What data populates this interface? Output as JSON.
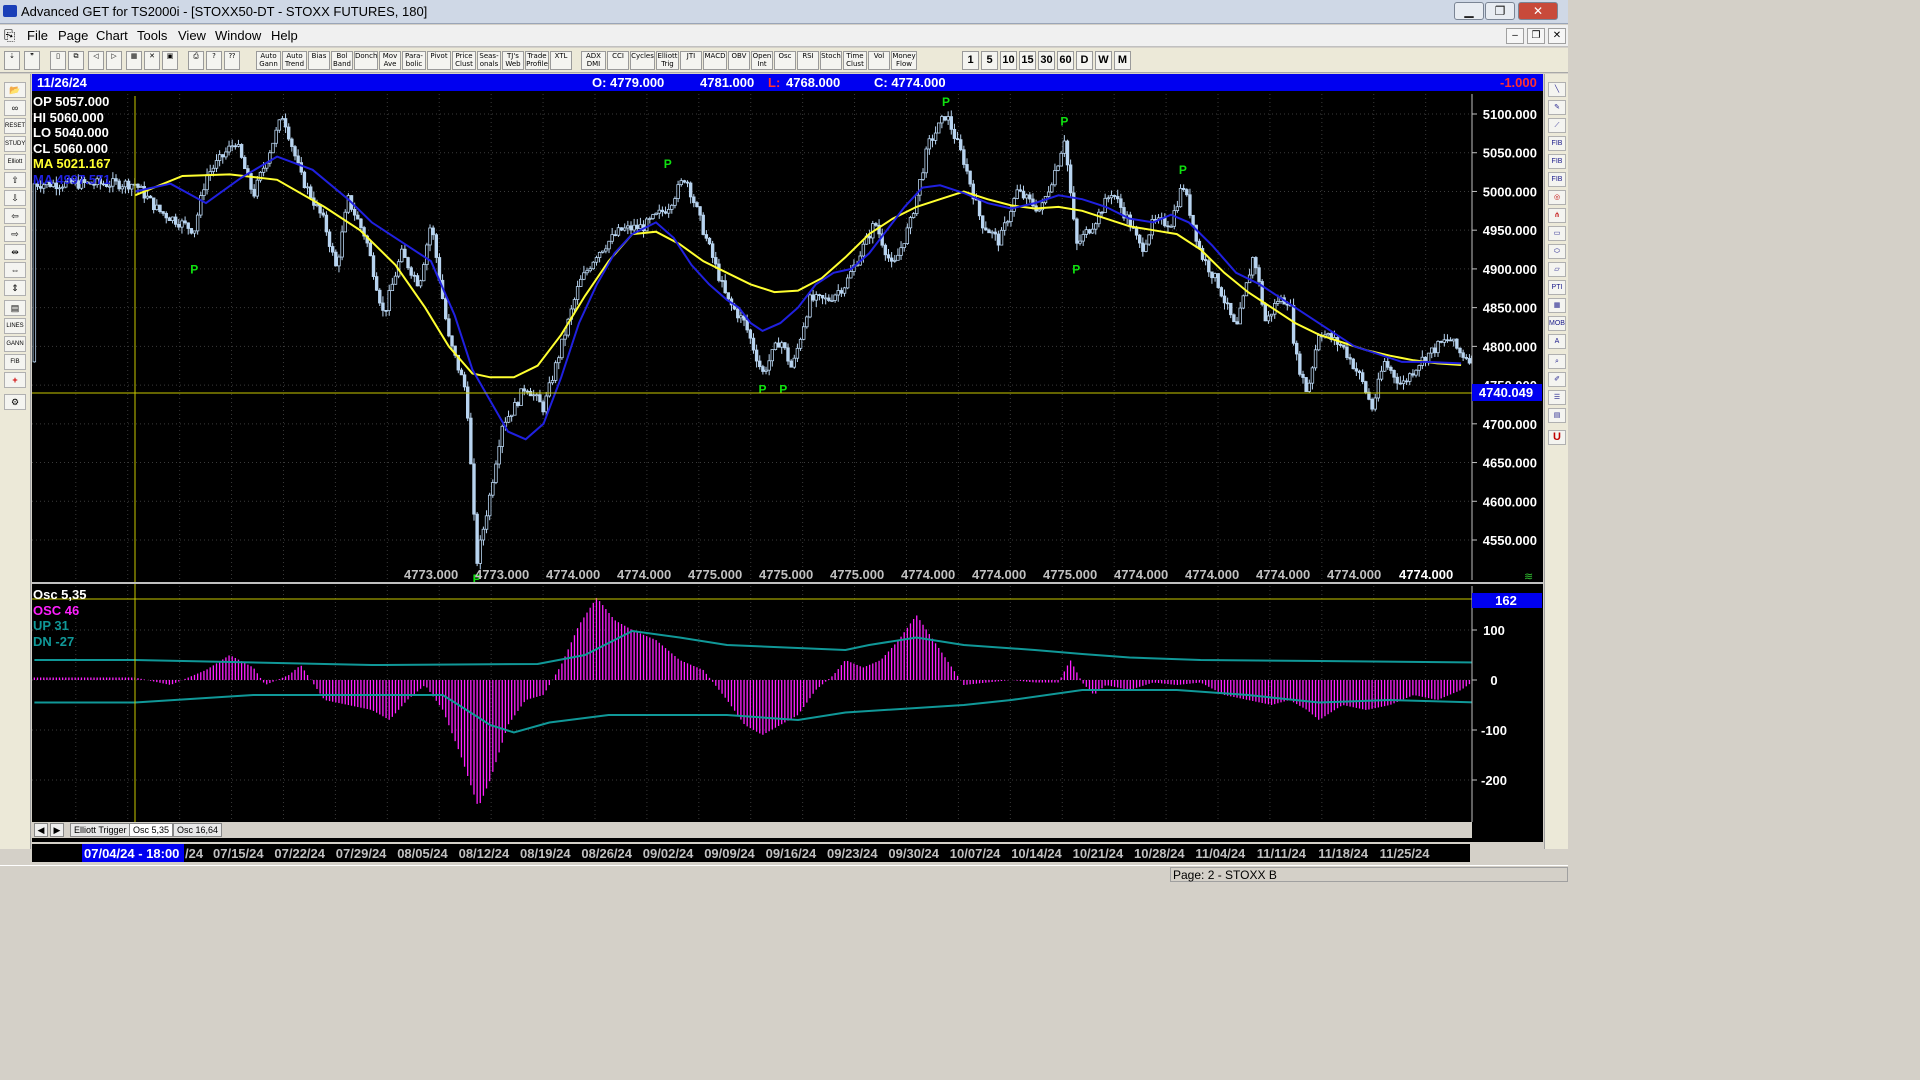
{
  "window": {
    "title": "Advanced GET for TS2000i - [STOXX50-DT - STOXX FUTURES, 180]",
    "min": "▁",
    "max": "❐",
    "close": "✕"
  },
  "menu": [
    "File",
    "Page",
    "Chart",
    "Tools",
    "View",
    "Window",
    "Help"
  ],
  "toolbar": {
    "groups": [
      "Auto Gann",
      "Auto Trend",
      "Bias",
      "Bol Band",
      "Donch",
      "Mov Ave",
      "Para-bolic",
      "Pivot",
      "Price Clust",
      "Seas-onals",
      "TJ's Web",
      "Trade Profile",
      "XTL",
      "ADX DMI",
      "CCI",
      "Cycles",
      "Elliott Trig",
      "JTI",
      "MACD",
      "OBV",
      "Open Int",
      "Osc",
      "RSI",
      "Stoch",
      "Time Clust",
      "Vol",
      "Money Flow"
    ],
    "timeframes": [
      "1",
      "5",
      "10",
      "15",
      "30",
      "60",
      "D",
      "W",
      "M"
    ]
  },
  "header": {
    "date": "11/26/24",
    "open": "O: 4779.000",
    "high": "4781.000",
    "low_label": "L:",
    "low": "4768.000",
    "close": "C: 4774.000",
    "change": "-1.000"
  },
  "legend": {
    "op": "OP  5057.000",
    "hi": "HI   5060.000",
    "lo": "LO  5040.000",
    "cl": "CL  5060.000",
    "ma1": "MA  5021.167",
    "ma2": "MA  4997.571"
  },
  "price_axis": {
    "ticks": [
      "5100.000",
      "5050.000",
      "5000.000",
      "4950.000",
      "4900.000",
      "4850.000",
      "4800.000",
      "4750.000",
      "4700.000",
      "4650.000",
      "4600.000",
      "4550.000"
    ],
    "cursor_price": "4740.049"
  },
  "bottom_values": [
    "4773.000",
    "4773.000",
    "4774.000",
    "4774.000",
    "4775.000",
    "4775.000",
    "4775.000",
    "4774.000",
    "4774.000",
    "4775.000",
    "4774.000",
    "4774.000",
    "4774.000",
    "4774.000"
  ],
  "last_value": "4774.000",
  "osc": {
    "title": "Osc 5,35",
    "osc": "OSC 46",
    "up": "UP   31",
    "dn": "DN   -27",
    "value_badge": "162",
    "ticks": [
      "100",
      "0",
      "-100",
      "-200"
    ]
  },
  "tabs": [
    "Elliott Trigger",
    "Osc 5,35",
    "Osc 16,64"
  ],
  "dates": {
    "cursor": "07/04/24 - 18:00",
    "labels": [
      "/24",
      "07/15/24",
      "07/22/24",
      "07/29/24",
      "08/05/24",
      "08/12/24",
      "08/19/24",
      "08/26/24",
      "09/02/24",
      "09/09/24",
      "09/16/24",
      "09/23/24",
      "09/30/24",
      "10/07/24",
      "10/14/24",
      "10/21/24",
      "10/28/24",
      "11/04/24",
      "11/11/24",
      "11/18/24",
      "11/25/24"
    ]
  },
  "status": {
    "page": "Page: 2 - STOXX B"
  },
  "pivot_label": "P",
  "colors": {
    "ma_fast": "#ffff30",
    "ma_slow": "#2020e0",
    "bars": "#b8d4f0",
    "pivot": "#10e010",
    "osc": "#ff20ff",
    "band": "#109898"
  },
  "chart_data": {
    "type": "candlestick",
    "ylim": [
      4510,
      5115
    ],
    "anchors": [
      [
        0,
        5010
      ],
      [
        0.02,
        4975
      ],
      [
        0.05,
        4950
      ],
      [
        0.06,
        5020
      ],
      [
        0.085,
        5065
      ],
      [
        0.1,
        4995
      ],
      [
        0.125,
        5100
      ],
      [
        0.14,
        5020
      ],
      [
        0.16,
        4960
      ],
      [
        0.17,
        4900
      ],
      [
        0.18,
        4990
      ],
      [
        0.195,
        4940
      ],
      [
        0.21,
        4840
      ],
      [
        0.225,
        4920
      ],
      [
        0.24,
        4880
      ],
      [
        0.25,
        4960
      ],
      [
        0.265,
        4810
      ],
      [
        0.28,
        4740
      ],
      [
        0.2885,
        4520
      ],
      [
        0.3,
        4610
      ],
      [
        0.31,
        4700
      ],
      [
        0.32,
        4720
      ],
      [
        0.33,
        4750
      ],
      [
        0.345,
        4720
      ],
      [
        0.36,
        4800
      ],
      [
        0.375,
        4880
      ],
      [
        0.39,
        4920
      ],
      [
        0.41,
        4950
      ],
      [
        0.43,
        4955
      ],
      [
        0.45,
        4980
      ],
      [
        0.465,
        5020
      ],
      [
        0.48,
        4950
      ],
      [
        0.5,
        4860
      ],
      [
        0.515,
        4830
      ],
      [
        0.53,
        4765
      ],
      [
        0.545,
        4810
      ],
      [
        0.555,
        4770
      ],
      [
        0.57,
        4860
      ],
      [
        0.585,
        4860
      ],
      [
        0.6,
        4880
      ],
      [
        0.625,
        4960
      ],
      [
        0.64,
        4900
      ],
      [
        0.655,
        4960
      ],
      [
        0.67,
        5060
      ],
      [
        0.685,
        5100
      ],
      [
        0.7,
        5040
      ],
      [
        0.715,
        4960
      ],
      [
        0.73,
        4935
      ],
      [
        0.745,
        5000
      ],
      [
        0.765,
        4975
      ],
      [
        0.78,
        5040
      ],
      [
        0.785,
        5070
      ],
      [
        0.795,
        4930
      ],
      [
        0.81,
        4960
      ],
      [
        0.825,
        5000
      ],
      [
        0.84,
        4960
      ],
      [
        0.85,
        4925
      ],
      [
        0.86,
        4960
      ],
      [
        0.875,
        4960
      ],
      [
        0.885,
        5010
      ],
      [
        0.9,
        4920
      ],
      [
        0.915,
        4880
      ],
      [
        0.93,
        4820
      ],
      [
        0.945,
        4920
      ],
      [
        0.955,
        4830
      ],
      [
        0.965,
        4860
      ],
      [
        0.975,
        4860
      ],
      [
        0.98,
        4790
      ],
      [
        0.99,
        4740
      ],
      [
        1.0,
        4820
      ],
      [
        1.02,
        4800
      ],
      [
        1.035,
        4760
      ],
      [
        1.045,
        4720
      ],
      [
        1.055,
        4780
      ],
      [
        1.07,
        4750
      ],
      [
        1.085,
        4780
      ],
      [
        1.1,
        4800
      ],
      [
        1.11,
        4810
      ],
      [
        1.12,
        4790
      ],
      [
        1.135,
        4780
      ]
    ],
    "ma_fast": [
      [
        0,
        4995
      ],
      [
        0.04,
        5020
      ],
      [
        0.08,
        5022
      ],
      [
        0.12,
        5015
      ],
      [
        0.16,
        4980
      ],
      [
        0.19,
        4950
      ],
      [
        0.22,
        4905
      ],
      [
        0.245,
        4850
      ],
      [
        0.265,
        4800
      ],
      [
        0.285,
        4765
      ],
      [
        0.3,
        4760
      ],
      [
        0.32,
        4760
      ],
      [
        0.34,
        4775
      ],
      [
        0.36,
        4815
      ],
      [
        0.38,
        4865
      ],
      [
        0.4,
        4910
      ],
      [
        0.42,
        4945
      ],
      [
        0.44,
        4948
      ],
      [
        0.46,
        4932
      ],
      [
        0.48,
        4910
      ],
      [
        0.5,
        4895
      ],
      [
        0.52,
        4880
      ],
      [
        0.54,
        4870
      ],
      [
        0.56,
        4872
      ],
      [
        0.58,
        4888
      ],
      [
        0.6,
        4915
      ],
      [
        0.62,
        4945
      ],
      [
        0.64,
        4965
      ],
      [
        0.66,
        4980
      ],
      [
        0.68,
        4990
      ],
      [
        0.7,
        5000
      ],
      [
        0.72,
        4990
      ],
      [
        0.74,
        4982
      ],
      [
        0.76,
        4978
      ],
      [
        0.78,
        4980
      ],
      [
        0.8,
        4975
      ],
      [
        0.82,
        4965
      ],
      [
        0.84,
        4955
      ],
      [
        0.86,
        4950
      ],
      [
        0.88,
        4945
      ],
      [
        0.9,
        4925
      ],
      [
        0.92,
        4895
      ],
      [
        0.94,
        4870
      ],
      [
        0.96,
        4850
      ],
      [
        0.98,
        4830
      ],
      [
        1.0,
        4815
      ],
      [
        1.02,
        4805
      ],
      [
        1.04,
        4795
      ],
      [
        1.06,
        4788
      ],
      [
        1.08,
        4782
      ],
      [
        1.1,
        4778
      ],
      [
        1.12,
        4776
      ]
    ],
    "ma_slow": [
      [
        0,
        5000
      ],
      [
        0.03,
        5010
      ],
      [
        0.06,
        4985
      ],
      [
        0.09,
        5018
      ],
      [
        0.12,
        5045
      ],
      [
        0.15,
        5028
      ],
      [
        0.18,
        4990
      ],
      [
        0.2,
        4960
      ],
      [
        0.22,
        4940
      ],
      [
        0.25,
        4910
      ],
      [
        0.27,
        4840
      ],
      [
        0.285,
        4770
      ],
      [
        0.3,
        4730
      ],
      [
        0.315,
        4690
      ],
      [
        0.33,
        4680
      ],
      [
        0.345,
        4700
      ],
      [
        0.36,
        4760
      ],
      [
        0.375,
        4830
      ],
      [
        0.39,
        4880
      ],
      [
        0.405,
        4920
      ],
      [
        0.42,
        4945
      ],
      [
        0.44,
        4960
      ],
      [
        0.455,
        4940
      ],
      [
        0.47,
        4905
      ],
      [
        0.485,
        4880
      ],
      [
        0.5,
        4860
      ],
      [
        0.51,
        4850
      ],
      [
        0.52,
        4830
      ],
      [
        0.53,
        4820
      ],
      [
        0.545,
        4830
      ],
      [
        0.56,
        4850
      ],
      [
        0.575,
        4880
      ],
      [
        0.59,
        4895
      ],
      [
        0.605,
        4900
      ],
      [
        0.62,
        4920
      ],
      [
        0.635,
        4950
      ],
      [
        0.65,
        4980
      ],
      [
        0.665,
        5005
      ],
      [
        0.68,
        5008
      ],
      [
        0.7,
        4998
      ],
      [
        0.72,
        4985
      ],
      [
        0.74,
        4978
      ],
      [
        0.76,
        4985
      ],
      [
        0.78,
        4995
      ],
      [
        0.8,
        4990
      ],
      [
        0.82,
        4980
      ],
      [
        0.84,
        4965
      ],
      [
        0.86,
        4960
      ],
      [
        0.875,
        4970
      ],
      [
        0.89,
        4960
      ],
      [
        0.91,
        4930
      ],
      [
        0.93,
        4895
      ],
      [
        0.95,
        4880
      ],
      [
        0.97,
        4860
      ],
      [
        0.99,
        4840
      ],
      [
        1.01,
        4820
      ],
      [
        1.03,
        4800
      ],
      [
        1.05,
        4790
      ],
      [
        1.07,
        4780
      ],
      [
        1.09,
        4780
      ],
      [
        1.12,
        4778
      ]
    ],
    "pivots": [
      {
        "x": 0.05,
        "y": 4920,
        "type": "low"
      },
      {
        "x": 0.2885,
        "y": 4520,
        "type": "low"
      },
      {
        "x": 0.45,
        "y": 5020,
        "type": "high"
      },
      {
        "x": 0.53,
        "y": 4765,
        "type": "low"
      },
      {
        "x": 0.5475,
        "y": 4765,
        "type": "low"
      },
      {
        "x": 0.685,
        "y": 5100,
        "type": "high"
      },
      {
        "x": 0.785,
        "y": 5075,
        "type": "high"
      },
      {
        "x": 0.795,
        "y": 4920,
        "type": "low"
      },
      {
        "x": 0.885,
        "y": 5012,
        "type": "high"
      }
    ],
    "osc_ylim": [
      -255,
      165
    ],
    "osc_anchors": [
      [
        0,
        5
      ],
      [
        0.03,
        -10
      ],
      [
        0.06,
        20
      ],
      [
        0.08,
        50
      ],
      [
        0.1,
        25
      ],
      [
        0.11,
        -10
      ],
      [
        0.13,
        10
      ],
      [
        0.14,
        30
      ],
      [
        0.15,
        -5
      ],
      [
        0.16,
        -40
      ],
      [
        0.18,
        -50
      ],
      [
        0.2,
        -60
      ],
      [
        0.215,
        -80
      ],
      [
        0.23,
        -40
      ],
      [
        0.245,
        -10
      ],
      [
        0.26,
        -60
      ],
      [
        0.275,
        -150
      ],
      [
        0.29,
        -255
      ],
      [
        0.3,
        -200
      ],
      [
        0.315,
        -90
      ],
      [
        0.33,
        -40
      ],
      [
        0.345,
        -30
      ],
      [
        0.36,
        30
      ],
      [
        0.375,
        110
      ],
      [
        0.39,
        165
      ],
      [
        0.405,
        120
      ],
      [
        0.42,
        100
      ],
      [
        0.44,
        80
      ],
      [
        0.46,
        40
      ],
      [
        0.48,
        20
      ],
      [
        0.5,
        -40
      ],
      [
        0.515,
        -90
      ],
      [
        0.53,
        -110
      ],
      [
        0.545,
        -90
      ],
      [
        0.56,
        -70
      ],
      [
        0.575,
        -20
      ],
      [
        0.59,
        10
      ],
      [
        0.6,
        40
      ],
      [
        0.615,
        25
      ],
      [
        0.63,
        40
      ],
      [
        0.645,
        80
      ],
      [
        0.66,
        130
      ],
      [
        0.68,
        60
      ],
      [
        0.7,
        -10
      ],
      [
        0.72,
        -5
      ],
      [
        0.74,
        0
      ],
      [
        0.76,
        -5
      ],
      [
        0.78,
        -5
      ],
      [
        0.79,
        40
      ],
      [
        0.8,
        -5
      ],
      [
        0.81,
        -30
      ],
      [
        0.82,
        -10
      ],
      [
        0.84,
        -20
      ],
      [
        0.86,
        -5
      ],
      [
        0.88,
        -10
      ],
      [
        0.9,
        -5
      ],
      [
        0.92,
        -30
      ],
      [
        0.94,
        -40
      ],
      [
        0.96,
        -50
      ],
      [
        0.975,
        -40
      ],
      [
        0.99,
        -60
      ],
      [
        1.0,
        -80
      ],
      [
        1.02,
        -50
      ],
      [
        1.04,
        -60
      ],
      [
        1.06,
        -50
      ],
      [
        1.08,
        -30
      ],
      [
        1.1,
        -40
      ],
      [
        1.12,
        -20
      ],
      [
        1.135,
        5
      ]
    ],
    "band_up": [
      [
        0,
        40
      ],
      [
        0.2,
        30
      ],
      [
        0.34,
        32
      ],
      [
        0.38,
        50
      ],
      [
        0.42,
        98
      ],
      [
        0.46,
        85
      ],
      [
        0.5,
        70
      ],
      [
        0.6,
        60
      ],
      [
        0.62,
        70
      ],
      [
        0.66,
        85
      ],
      [
        0.7,
        70
      ],
      [
        0.76,
        60
      ],
      [
        0.8,
        52
      ],
      [
        0.84,
        45
      ],
      [
        0.9,
        40
      ],
      [
        1.0,
        38
      ],
      [
        1.135,
        35
      ]
    ],
    "band_dn": [
      [
        0,
        -45
      ],
      [
        0.1,
        -30
      ],
      [
        0.26,
        -30
      ],
      [
        0.3,
        -90
      ],
      [
        0.32,
        -105
      ],
      [
        0.35,
        -85
      ],
      [
        0.4,
        -70
      ],
      [
        0.5,
        -70
      ],
      [
        0.56,
        -80
      ],
      [
        0.6,
        -65
      ],
      [
        0.7,
        -50
      ],
      [
        0.74,
        -40
      ],
      [
        0.8,
        -20
      ],
      [
        0.88,
        -20
      ],
      [
        0.94,
        -30
      ],
      [
        1.0,
        -45
      ],
      [
        1.06,
        -40
      ],
      [
        1.135,
        -45
      ]
    ]
  }
}
